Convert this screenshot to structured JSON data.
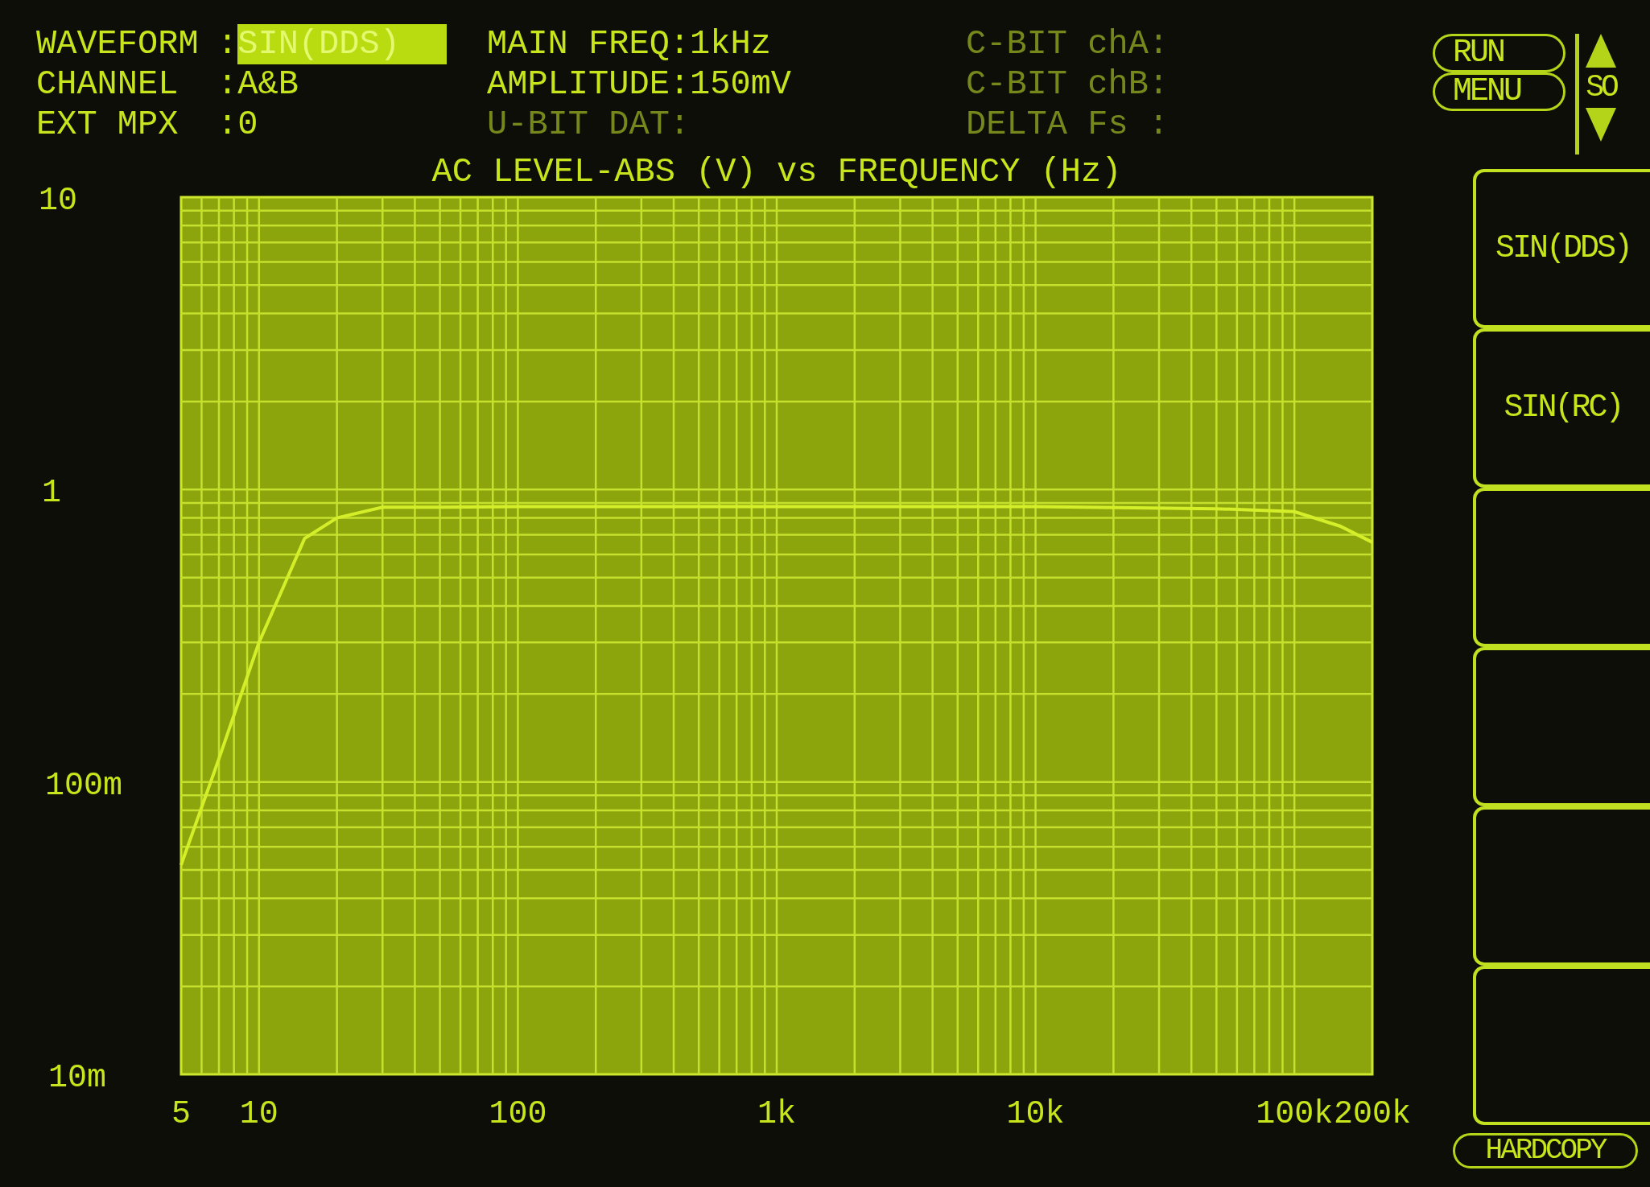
{
  "status_columns": [
    {
      "fields": [
        {
          "label": "WAVEFORM",
          "separator": ":",
          "value": "SIN(DDS)",
          "highlighted": true
        },
        {
          "label": "CHANNEL",
          "separator": ":",
          "value": "A&B",
          "highlighted": false
        },
        {
          "label": "EXT MPX",
          "separator": ":",
          "value": "0",
          "highlighted": false
        }
      ]
    },
    {
      "fields": [
        {
          "label": "MAIN FREQ:",
          "value": "1kHz",
          "dim": false
        },
        {
          "label": "AMPLITUDE:",
          "value": "150mV",
          "dim": false
        },
        {
          "label": "U-BIT DAT:",
          "dim": true
        }
      ]
    },
    {
      "fields": [
        {
          "label": "C-BIT chA:",
          "dim": true
        },
        {
          "label": "C-BIT chB:",
          "dim": true
        },
        {
          "label": "DELTA Fs :",
          "dim": true
        }
      ]
    }
  ],
  "top_buttons": [
    "RUN",
    "MENU"
  ],
  "scroll_label": "SO",
  "chart": {
    "title": "AC LEVEL-ABS (V) vs FREQUENCY (Hz)"
  },
  "x_axis_labels": [
    "5",
    "10",
    "100",
    "1k",
    "10k",
    "100k",
    "200k"
  ],
  "y_axis_labels": [
    "10",
    "1",
    "100m",
    "10m"
  ],
  "softkeys": [
    {
      "kind": "labeled",
      "label": "SIN(DDS)"
    },
    {
      "kind": "labeled",
      "label": "SIN(RC)"
    },
    {
      "kind": "blank"
    },
    {
      "kind": "blank"
    },
    {
      "kind": "blank"
    },
    {
      "kind": "blank"
    }
  ],
  "hardcopy_button": "HARDCOPY"
}
